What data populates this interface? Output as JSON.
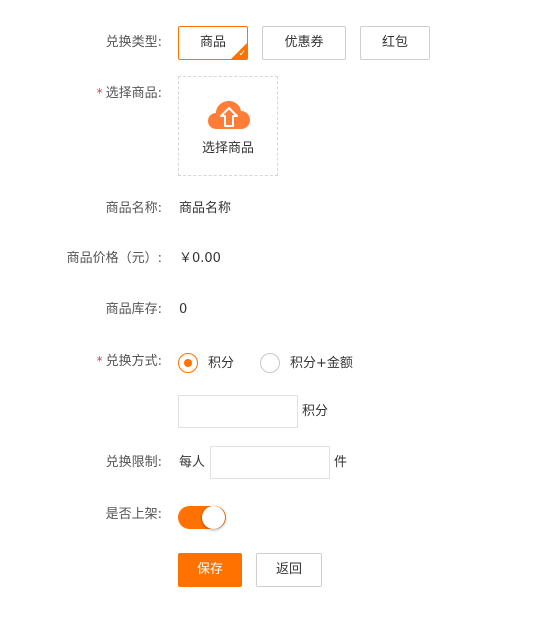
{
  "form": {
    "exchange_type": {
      "label": "兑换类型:",
      "options": [
        "商品",
        "优惠券",
        "红包"
      ],
      "selected": "商品"
    },
    "select_product": {
      "required_mark": "*",
      "label": "选择商品:",
      "upload_text": "选择商品"
    },
    "product_name": {
      "label": "商品名称:",
      "value": "商品名称"
    },
    "product_price": {
      "label": "商品价格（元）:",
      "value": "￥0.00"
    },
    "product_stock": {
      "label": "商品库存:",
      "value": "0"
    },
    "exchange_method": {
      "required_mark": "*",
      "label": "兑换方式:",
      "options": [
        "积分",
        "积分+金额"
      ],
      "selected": "积分",
      "points_value": "",
      "points_suffix": "积分"
    },
    "exchange_limit": {
      "label": "兑换限制:",
      "prefix": "每人",
      "value": "",
      "suffix": "件"
    },
    "listed": {
      "label": "是否上架:",
      "on": true
    }
  },
  "actions": {
    "save_label": "保存",
    "back_label": "返回"
  },
  "colors": {
    "accent": "#ff7200",
    "required": "#e4393c",
    "border": "#cfcfcf"
  }
}
